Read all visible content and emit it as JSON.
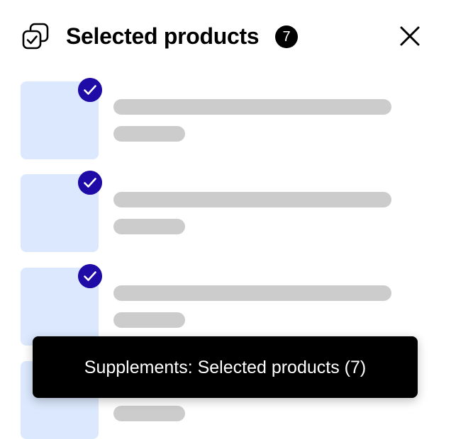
{
  "header": {
    "title": "Selected products",
    "count": "7",
    "icon": "selected-products-icon",
    "close_icon": "close-icon"
  },
  "list": {
    "items": [
      {
        "selected": true,
        "thumbnail_color": "#dbe8fd"
      },
      {
        "selected": true,
        "thumbnail_color": "#dbe8fd"
      },
      {
        "selected": true,
        "thumbnail_color": "#dbe8fd"
      },
      {
        "selected": true,
        "thumbnail_color": "#dbe8fd"
      }
    ],
    "loading": true
  },
  "toast": {
    "message": "Supplements: Selected products (7)"
  },
  "colors": {
    "accent": "#1f0ba5",
    "skeleton": "#cccccc",
    "thumbnail": "#dbe8fd",
    "toast_background": "#000000"
  }
}
